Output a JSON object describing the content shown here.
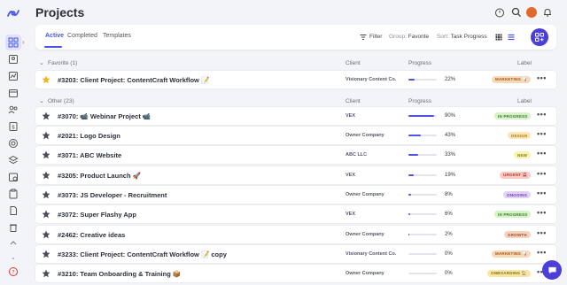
{
  "header": {
    "title": "Projects"
  },
  "toolbar": {
    "tabs": [
      {
        "label": "Active"
      },
      {
        "label": "Completed"
      },
      {
        "label": "Templates"
      }
    ],
    "filter_label": "Filter",
    "group_prefix": "Group:",
    "group_value": "Favorite",
    "sort_prefix": "Sort:",
    "sort_value": "Task Progress"
  },
  "columns": {
    "client": "Client",
    "progress": "Progress",
    "label": "Label"
  },
  "sections": [
    {
      "name": "Favorite (1)"
    },
    {
      "name": "Other (23)"
    }
  ],
  "rows": [
    {
      "name": "#3203: Client Project: ContentCraft Workflow 📝",
      "client": "Visionary Content Co.",
      "progress": 22,
      "progress_text": "22%",
      "label": "MARKETING 📊",
      "favorite": true,
      "label_bg": "#f7d9b8",
      "label_fg": "#a0561a"
    },
    {
      "name": "#3070: 📹 Webinar Project 📹",
      "client": "VEX",
      "progress": 90,
      "progress_text": "90%",
      "label": "IN PROGRESS",
      "favorite": false,
      "label_bg": "#d6f2c9",
      "label_fg": "#3f7d2a"
    },
    {
      "name": "#2021: Logo Design",
      "client": "Owner Company",
      "progress": 43,
      "progress_text": "43%",
      "label": "DESIGN",
      "favorite": false,
      "label_bg": "#fbe6b8",
      "label_fg": "#b07a10"
    },
    {
      "name": "#3071: ABC Website",
      "client": "ABC LLC",
      "progress": 33,
      "progress_text": "33%",
      "label": "NEW",
      "favorite": false,
      "label_bg": "#f6f3b4",
      "label_fg": "#8a7a10"
    },
    {
      "name": "#3205: Product Launch 🚀",
      "client": "VEX",
      "progress": 19,
      "progress_text": "19%",
      "label": "URGENT 🚨",
      "favorite": false,
      "label_bg": "#f9c9c4",
      "label_fg": "#b33a2c"
    },
    {
      "name": "#3073: JS Developer - Recruitment",
      "client": "Owner Company",
      "progress": 8,
      "progress_text": "8%",
      "label": "ONGOING",
      "favorite": false,
      "label_bg": "#e2d3f6",
      "label_fg": "#6b3fb0"
    },
    {
      "name": "#3072: Super Flashy App",
      "client": "VEX",
      "progress": 6,
      "progress_text": "6%",
      "label": "IN PROGRESS",
      "favorite": false,
      "label_bg": "#d6f2c9",
      "label_fg": "#3f7d2a"
    },
    {
      "name": "#2462: Creative ideas",
      "client": "Owner Company",
      "progress": 2,
      "progress_text": "2%",
      "label": "GROWTH",
      "favorite": false,
      "label_bg": "#f4d3c0",
      "label_fg": "#a34e20"
    },
    {
      "name": "#3233: Client Project: ContentCraft Workflow 📝 copy",
      "client": "Visionary Content Co.",
      "progress": 0,
      "progress_text": "0%",
      "label": "MARKETING 📊",
      "favorite": false,
      "label_bg": "#f7d9b8",
      "label_fg": "#a0561a"
    },
    {
      "name": "#3210: Team Onboarding & Training 📦",
      "client": "Owner Company",
      "progress": 0,
      "progress_text": "0%",
      "label": "ONBOARDING 🏠",
      "favorite": false,
      "label_bg": "#f6e7a6",
      "label_fg": "#8c6d0c"
    }
  ],
  "colors": {
    "accent": "#4a56e2",
    "fab": "#4b3fd8",
    "star_fav": "#f2b32a",
    "star": "#4a4e58"
  }
}
